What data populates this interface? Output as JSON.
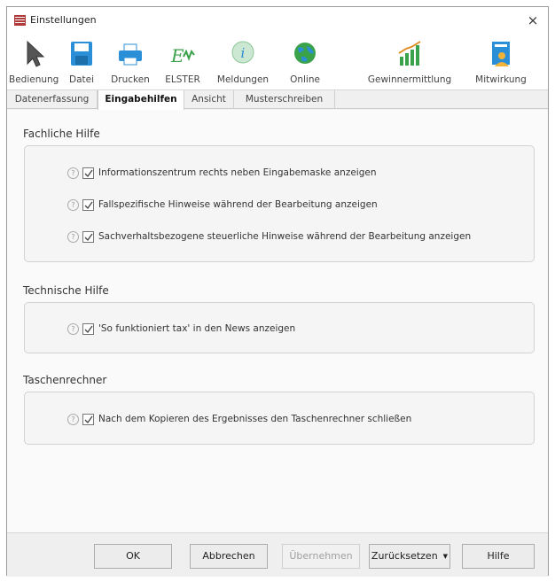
{
  "window": {
    "title": "Einstellungen",
    "close_glyph": "×"
  },
  "toolbar": {
    "items": [
      {
        "label": "Bedienung",
        "icon": "cursor-icon"
      },
      {
        "label": "Datei",
        "icon": "floppy-disk-icon"
      },
      {
        "label": "Drucken",
        "icon": "printer-icon"
      },
      {
        "label": "ELSTER",
        "icon": "elster-icon"
      },
      {
        "label": "Meldungen",
        "icon": "info-bubble-icon"
      },
      {
        "label": "Online",
        "icon": "globe-icon"
      },
      {
        "label": "Gewinnermittlung",
        "icon": "bar-chart-icon"
      },
      {
        "label": "Mitwirkung",
        "icon": "user-document-icon"
      }
    ]
  },
  "tabs": [
    {
      "label": "Datenerfassung"
    },
    {
      "label": "Eingabehilfen",
      "active": true
    },
    {
      "label": "Ansicht"
    },
    {
      "label": "Musterschreiben"
    }
  ],
  "sections": {
    "fachliche": {
      "title": "Fachliche Hilfe",
      "options": [
        {
          "label": "Informationszentrum rechts neben Eingabemaske anzeigen",
          "checked": true
        },
        {
          "label": "Fallspezifische Hinweise während der Bearbeitung anzeigen",
          "checked": true
        },
        {
          "label": "Sachverhaltsbezogene steuerliche Hinweise während der Bearbeitung anzeigen",
          "checked": true
        }
      ]
    },
    "technische": {
      "title": "Technische Hilfe",
      "options": [
        {
          "label": "'So funktioniert tax' in den News anzeigen",
          "checked": true
        }
      ]
    },
    "taschenrechner": {
      "title": "Taschenrechner",
      "options": [
        {
          "label": "Nach dem Kopieren des Ergebnisses den Taschenrechner schließen",
          "checked": true
        }
      ]
    }
  },
  "help_glyph": "?",
  "buttons": {
    "ok": "OK",
    "abbrechen": "Abbrechen",
    "uebernehmen": "Übernehmen",
    "zuruecksetzen": "Zurücksetzen",
    "hilfe": "Hilfe"
  },
  "colors": {
    "accent_blue": "#2a8fd6",
    "accent_green": "#3aa24a",
    "checkmark": "#444444"
  }
}
